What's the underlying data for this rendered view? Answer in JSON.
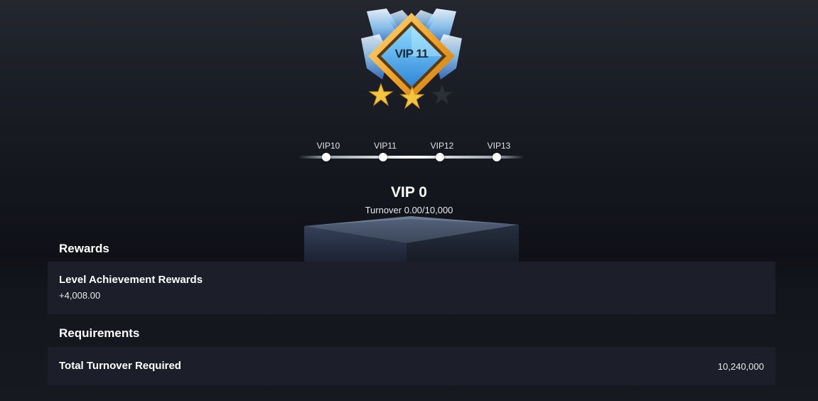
{
  "badge": {
    "label": "VIP 11",
    "stars_filled": 2,
    "stars_total": 3
  },
  "level_track": {
    "levels": [
      "VIP10",
      "VIP11",
      "VIP12",
      "VIP13"
    ]
  },
  "current": {
    "title": "VIP 0",
    "turnover": "Turnover 0.00/10,000"
  },
  "rewards": {
    "heading": "Rewards",
    "item_title": "Level Achievement Rewards",
    "item_value": "+4,008.00"
  },
  "requirements": {
    "heading": "Requirements",
    "item_title": "Total Turnover Required",
    "item_value": "10,240,000"
  },
  "colors": {
    "background": "#12141b",
    "card": "#1c1f29",
    "gold": "#f0b640",
    "crystal": "#6ec3f0"
  }
}
